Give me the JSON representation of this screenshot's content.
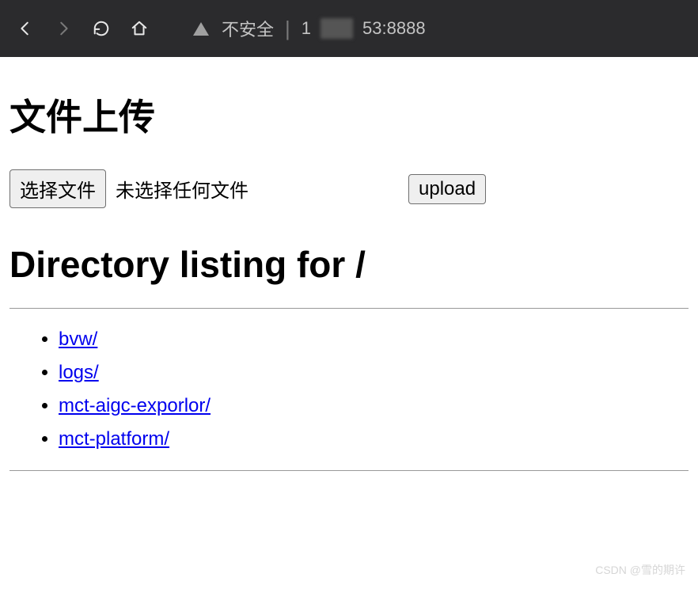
{
  "toolbar": {
    "insecure_label": "不安全",
    "address_prefix": "1",
    "address_mid_hidden": "xxx",
    "address_suffix": "53:8888"
  },
  "upload": {
    "title": "文件上传",
    "choose_file_label": "选择文件",
    "no_file_text": "未选择任何文件",
    "upload_label": "upload"
  },
  "listing": {
    "title": "Directory listing for /",
    "items": [
      {
        "label": "bvw/"
      },
      {
        "label": "logs/"
      },
      {
        "label": "mct-aigc-exporlor/"
      },
      {
        "label": "mct-platform/"
      }
    ]
  },
  "watermark": "CSDN @雪的期许"
}
